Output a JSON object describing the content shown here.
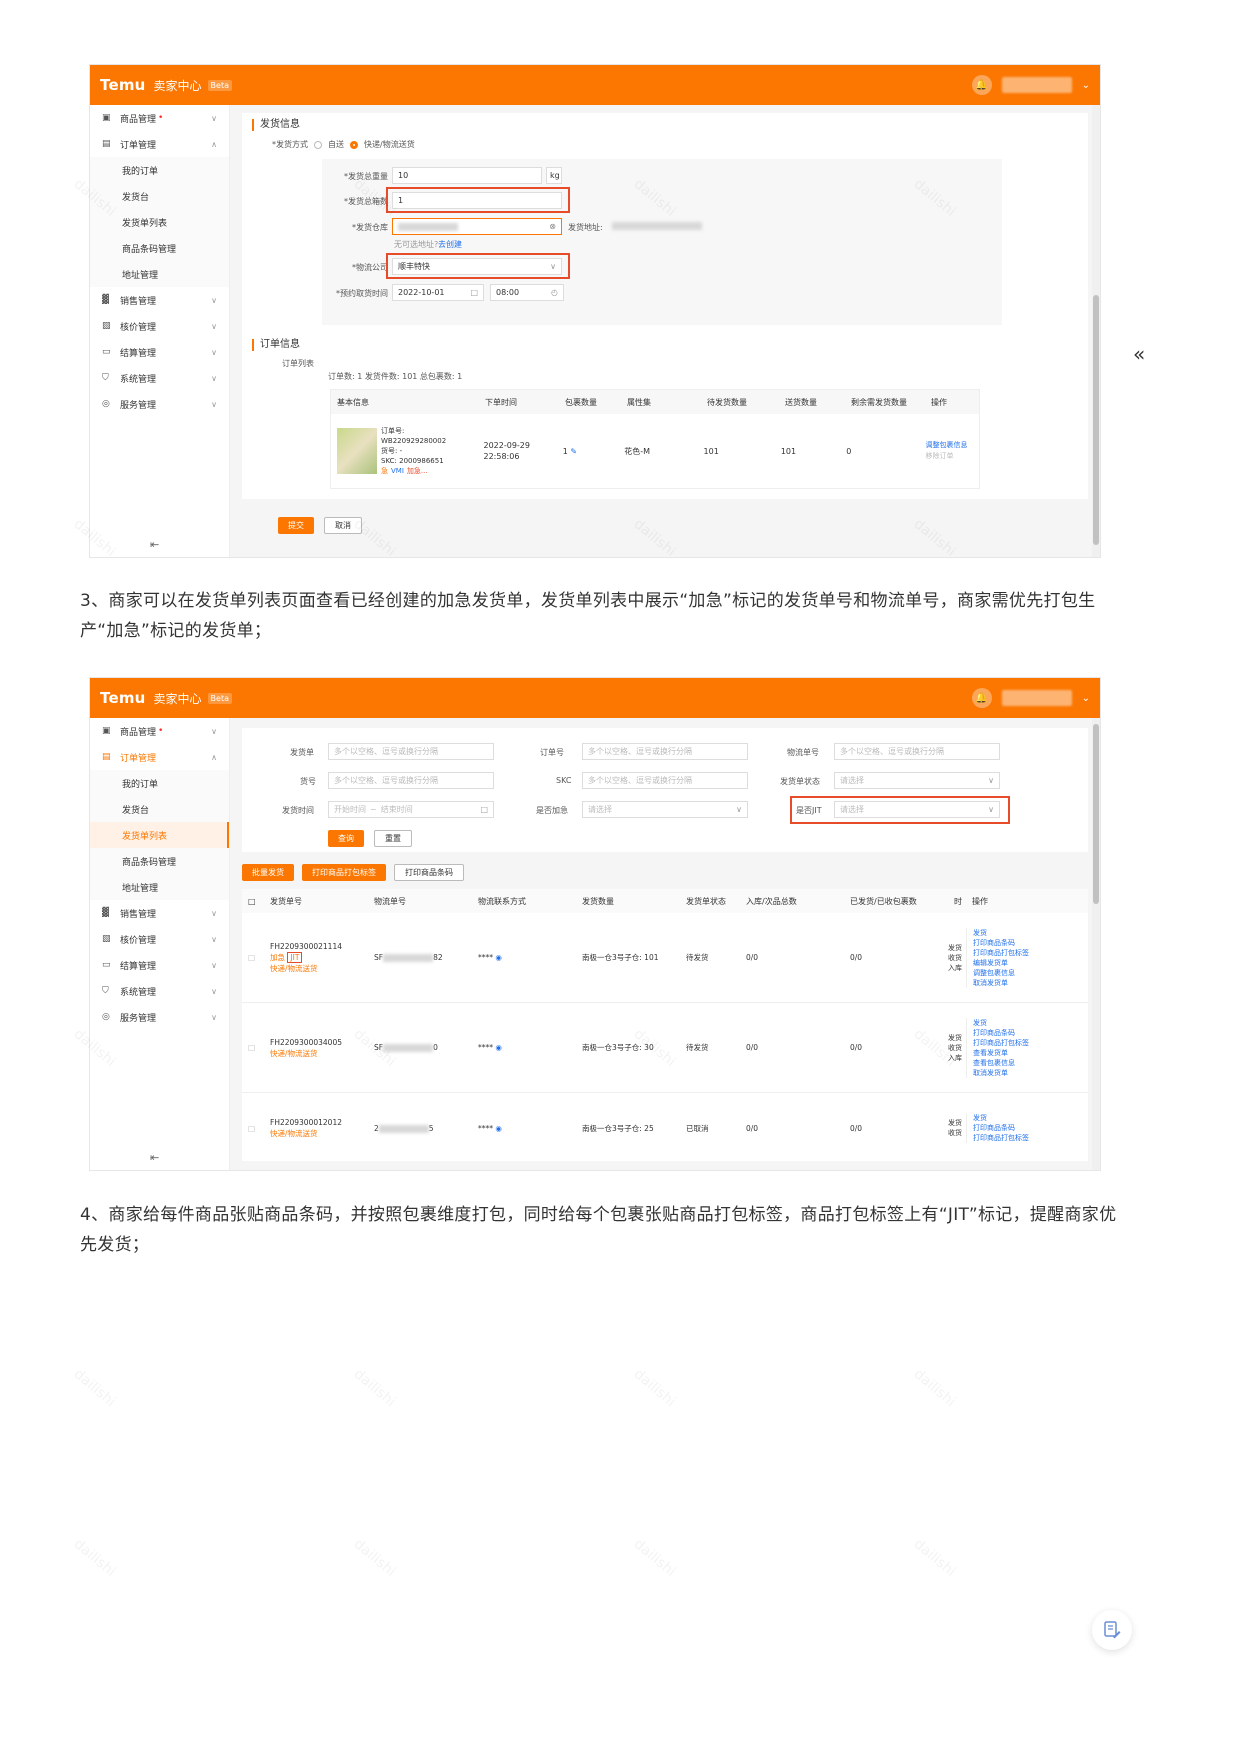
{
  "app": {
    "brand": "Temu",
    "brand_cn": "卖家中心",
    "beta": "Beta"
  },
  "sidebar": {
    "items": [
      {
        "label": "商品管理",
        "dot": "•",
        "icon": "goods-icon"
      },
      {
        "label": "订单管理",
        "icon": "order-icon"
      },
      {
        "label": "销售管理",
        "icon": "sales-icon"
      },
      {
        "label": "核价管理",
        "icon": "price-icon"
      },
      {
        "label": "结算管理",
        "icon": "settle-icon"
      },
      {
        "label": "系统管理",
        "icon": "system-icon"
      },
      {
        "label": "服务管理",
        "icon": "service-icon"
      }
    ],
    "order_sub": [
      "我的订单",
      "发货台",
      "发货单列表",
      "商品条码管理",
      "地址管理"
    ],
    "collapse": "⇤"
  },
  "screen1": {
    "ship_info_title": "发货信息",
    "ship_method_label": "*发货方式",
    "ship_method_opt1": "自送",
    "ship_method_opt2": "快递/物流送货",
    "total_weight_label": "*发货总重量",
    "total_weight_value": "10",
    "weight_unit": "kg",
    "total_pkg_label": "*发货总箱数",
    "total_pkg_value": "1",
    "warehouse_label": "*发货仓库",
    "warehouse_addr_label": "发货地址:",
    "no_addr_hint": "无可选地址?",
    "create_link": "去创建",
    "logistics_label": "*物流公司",
    "logistics_value": "顺丰特快",
    "pickup_label": "*预约取货时间",
    "pickup_date": "2022-10-01",
    "pickup_time": "08:00",
    "order_info_title": "订单信息",
    "order_list_label": "订单列表",
    "summary": "订单数: 1    发货件数: 101    总包裹数: 1",
    "columns": [
      "基本信息",
      "下单时间",
      "包裹数量",
      "属性集",
      "待发货数量",
      "送货数量",
      "剩余需发货数量",
      "操作"
    ],
    "row": {
      "order_no_label": "订单号:",
      "order_no": "WB220929280002",
      "goods_no": "货号: -",
      "skc": "SKC: 2000986651",
      "tags": [
        "急",
        "VMI",
        "加急..."
      ],
      "time": "2022-09-29",
      "time2": "22:58:06",
      "packages": "1",
      "attr": "花色-M",
      "pending": "101",
      "deliver": "101",
      "remaining": "0",
      "op1": "调整包裹信息",
      "op2": "移除订单"
    },
    "submit": "提交",
    "cancel": "取消"
  },
  "paragraph1": "3、商家可以在发货单列表页面查看已经创建的加急发货单，发货单列表中展示“加急”标记的发货单号和物流单号，商家需优先打包生产“加急”标记的发货单；",
  "screen2": {
    "filters": {
      "ship_no": "发货单",
      "order_no": "订单号",
      "logistics_no": "物流单号",
      "goods_no": "货号",
      "skc": "SKC",
      "status": "发货单状态",
      "ship_time": "发货时间",
      "urgent": "是否加急",
      "jit": "是否JIT",
      "placeholder_multi": "多个以空格、逗号或换行分隔",
      "placeholder_select": "请选择",
      "placeholder_start": "开始时间",
      "placeholder_end": "结束时间",
      "range_sep": "~"
    },
    "query": "查询",
    "reset": "重置",
    "batch_ship": "批量发货",
    "print_pkg_label": "打印商品打包标签",
    "print_barcode": "打印商品条码",
    "columns": [
      "发货单号",
      "物流单号",
      "物流联系方式",
      "发货数量",
      "发货单状态",
      "入库/次品总数",
      "已发货/已收包裹数",
      "时",
      "操作"
    ],
    "rows": [
      {
        "no": "FH2209300021114",
        "tags": [
          "加急",
          "JIT"
        ],
        "method": "快递/物流送货",
        "log": "SF",
        "log_end": "82",
        "contact": "****",
        "qty": "南极一仓3号子仓: 101",
        "status": "待发货",
        "in": "0/0",
        "pkg": "0/0",
        "t": [
          "发货",
          "收货",
          "入库"
        ],
        "ops": [
          "发货",
          "打印商品条码",
          "打印商品打包标签",
          "编辑发货单",
          "调整包裹信息",
          "取消发货单"
        ]
      },
      {
        "no": "FH2209300034005",
        "tags": [],
        "method": "快递/物流送货",
        "log": "SF",
        "log_end": "0",
        "contact": "****",
        "qty": "南极一仓3号子仓: 30",
        "status": "待发货",
        "in": "0/0",
        "pkg": "0/0",
        "t": [
          "发货",
          "收货",
          "入库"
        ],
        "ops": [
          "发货",
          "打印商品条码",
          "打印商品打包标签",
          "查看发货单",
          "查看包裹信息",
          "取消发货单"
        ]
      },
      {
        "no": "FH2209300012012",
        "tags": [],
        "method": "快递/物流送货",
        "log": "2",
        "log_end": "5",
        "contact": "****",
        "qty": "南极一仓3号子仓: 25",
        "status": "已取消",
        "in": "0/0",
        "pkg": "0/0",
        "t": [
          "发货",
          "收货"
        ],
        "ops": [
          "发货",
          "打印商品条码",
          "打印商品打包标签"
        ]
      }
    ]
  },
  "paragraph2": "4、商家给每件商品张贴商品条码，并按照包裹维度打包，同时给每个包裹张贴商品打包标签，商品打包标签上有“JIT”标记，提醒商家优先发货；",
  "aside": {
    "collapse_arrows": "«"
  },
  "watermark": "dailishi"
}
